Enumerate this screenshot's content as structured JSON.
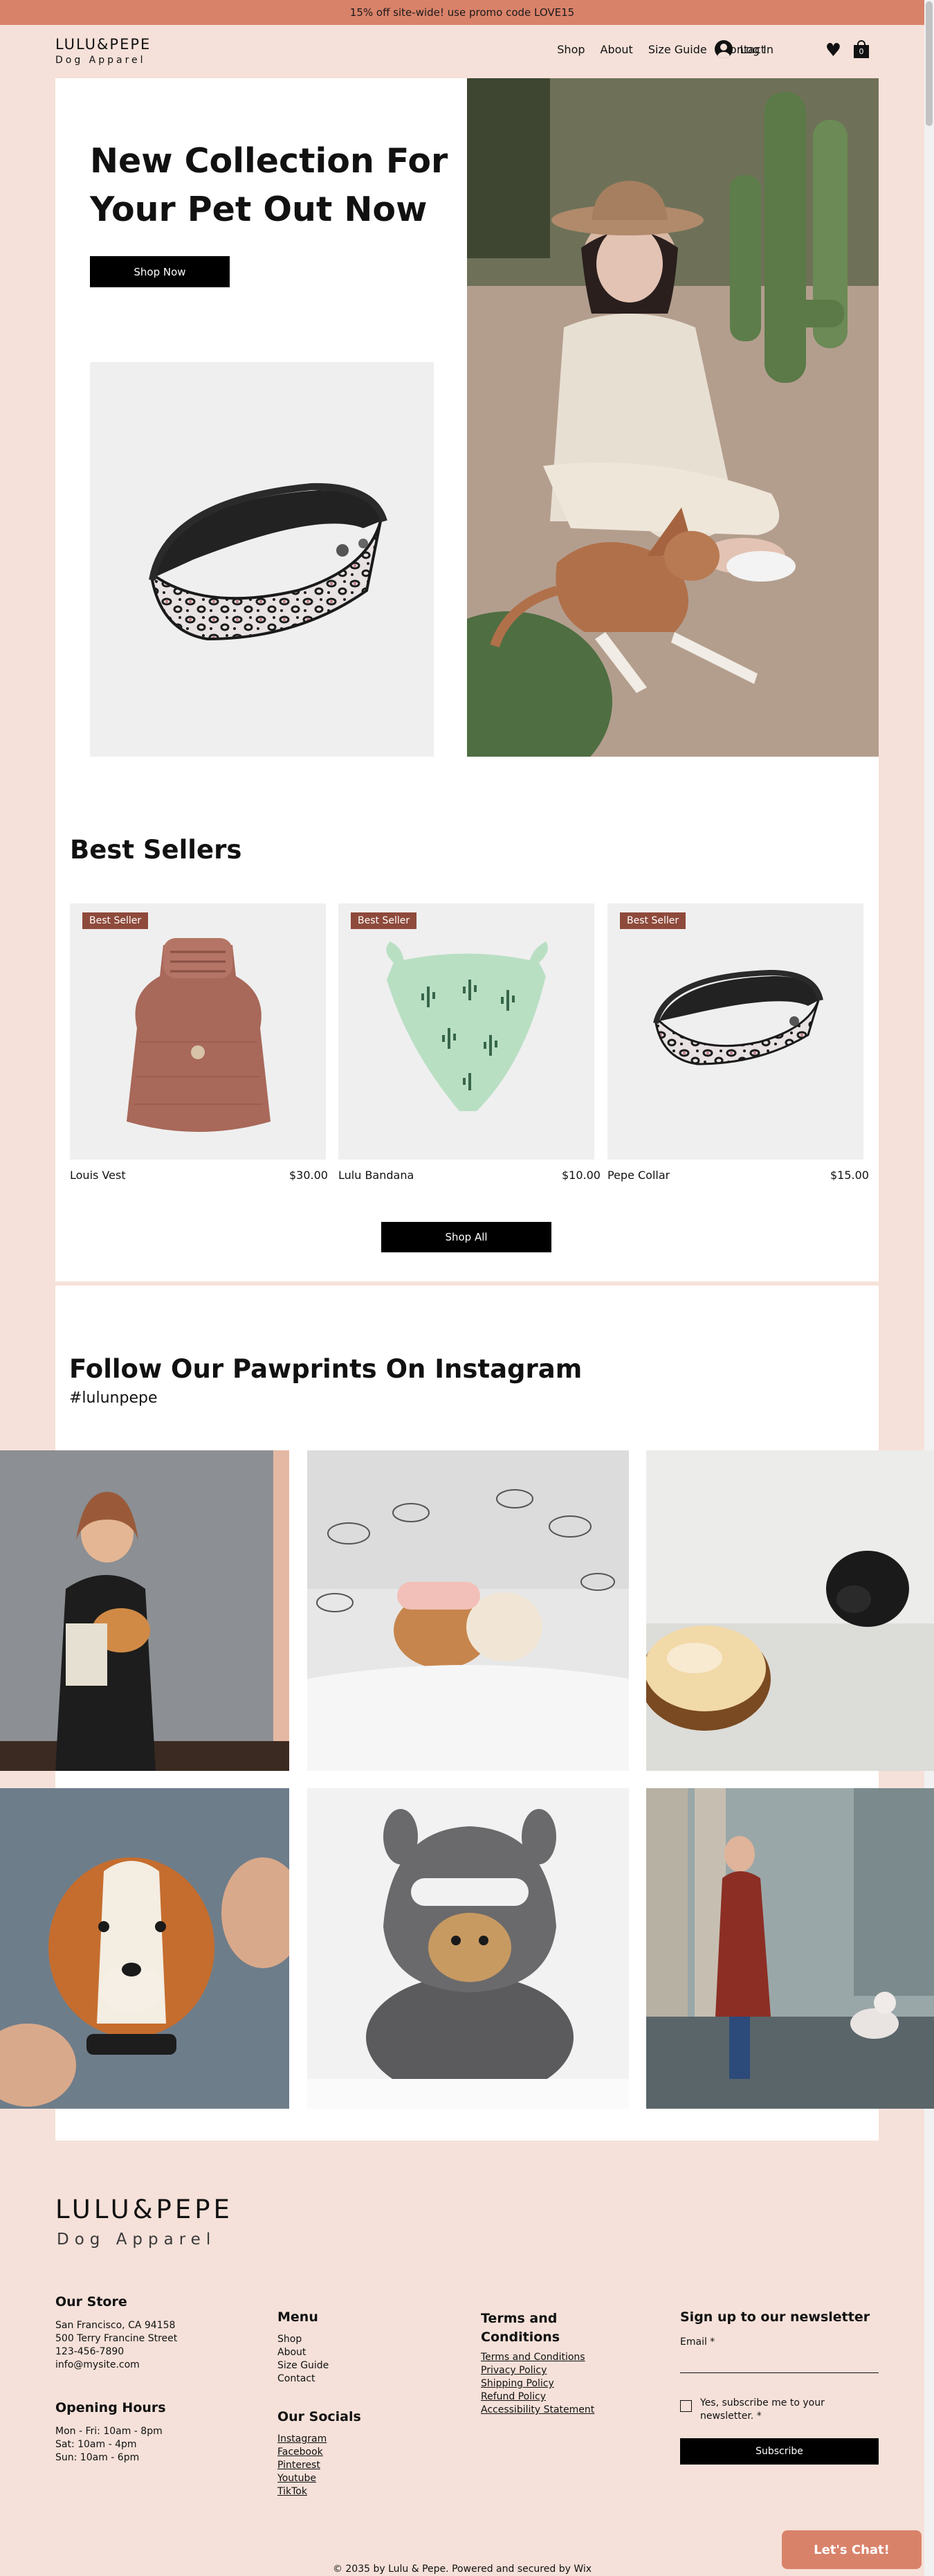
{
  "promo": {
    "text": "15% off site-wide! use promo code LOVE15"
  },
  "brand": {
    "name": "LULU&PEPE",
    "tagline": "Dog Apparel"
  },
  "nav": {
    "items": [
      "Shop",
      "About",
      "Size Guide",
      "Contact"
    ],
    "login_label": "Log In",
    "cart_count": "0",
    "icons": {
      "login": "user-avatar-icon",
      "wishlist": "heart-icon",
      "cart": "shopping-bag-icon"
    }
  },
  "hero": {
    "title": "New Collection For Your Pet Out Now",
    "button": "Shop Now"
  },
  "best_sellers": {
    "title": "Best Sellers",
    "badge": "Best Seller",
    "products": [
      {
        "name": "Louis Vest",
        "price": "$30.00"
      },
      {
        "name": "Lulu Bandana",
        "price": "$10.00"
      },
      {
        "name": "Pepe Collar",
        "price": "$15.00"
      }
    ],
    "button": "Shop All"
  },
  "instagram": {
    "title": "Follow Our Pawprints On Instagram",
    "hashtag": "#lulunpepe"
  },
  "footer": {
    "store": {
      "title": "Our Store",
      "lines": [
        "San Francisco, CA 94158",
        "500 Terry Francine Street",
        "123-456-7890",
        "info@mysite.com"
      ]
    },
    "hours": {
      "title": "Opening Hours",
      "lines": [
        "Mon - Fri: 10am - 8pm",
        "Sat: 10am - 4pm",
        "Sun: 10am - 6pm"
      ]
    },
    "menu": {
      "title": "Menu",
      "items": [
        "Shop",
        "About",
        "Size Guide",
        "Contact"
      ]
    },
    "socials": {
      "title": "Our Socials",
      "items": [
        "Instagram",
        "Facebook",
        "Pinterest",
        "Youtube",
        "TikTok"
      ]
    },
    "terms": {
      "title": "Terms and Conditions",
      "items": [
        "Terms and Conditions",
        "Privacy Policy",
        "Shipping Policy",
        "Refund Policy",
        "Accessibility Statement"
      ]
    },
    "newsletter": {
      "title": "Sign up to our newsletter",
      "email_label": "Email *",
      "email_value": "",
      "checkbox_label": "Yes, subscribe me to your newsletter. *",
      "button": "Subscribe"
    },
    "copyright": "© 2035 by Lulu & Pepe. Powered and secured by Wix"
  },
  "chat": {
    "label": "Let's Chat!"
  },
  "colors": {
    "background": "#f5e1d9",
    "promo": "#d9826a",
    "badge": "#8e4a3b",
    "button": "#000000"
  }
}
